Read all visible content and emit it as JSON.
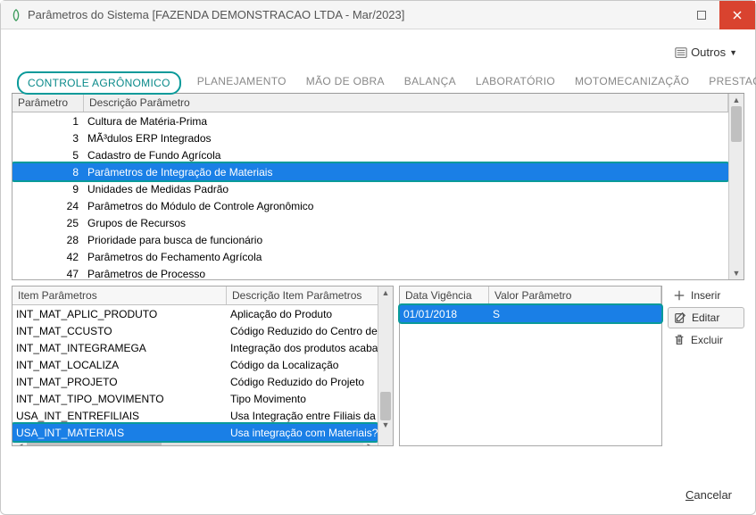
{
  "window": {
    "title": "Parâmetros do Sistema [FAZENDA DEMONSTRACAO LTDA - Mar/2023]"
  },
  "topbar": {
    "outros_label": "Outros"
  },
  "tabs": {
    "items": [
      "CONTROLE AGRÔNOMICO",
      "PLANEJAMENTO",
      "MÃO DE OBRA",
      "BALANÇA",
      "LABORATÓRIO",
      "MOTOMECANIZAÇÃO",
      "PRESTAÇÃO DE SERVIÇOS"
    ],
    "active_index": 0
  },
  "grid1": {
    "headers": {
      "param": "Parâmetro",
      "desc": "Descrição Parâmetro"
    },
    "rows": [
      {
        "id": "1",
        "desc": "Cultura de Matéria-Prima"
      },
      {
        "id": "3",
        "desc": "MÃ³dulos ERP Integrados"
      },
      {
        "id": "5",
        "desc": "Cadastro de Fundo Agrícola"
      },
      {
        "id": "8",
        "desc": "Parâmetros de Integração de Materiais",
        "selected": true
      },
      {
        "id": "9",
        "desc": "Unidades de Medidas Padrão"
      },
      {
        "id": "24",
        "desc": "Parâmetros do Módulo de Controle Agronômico"
      },
      {
        "id": "25",
        "desc": "Grupos de Recursos"
      },
      {
        "id": "28",
        "desc": "Prioridade para busca de funcionário"
      },
      {
        "id": "42",
        "desc": "Parâmetros do Fechamento Agrícola"
      },
      {
        "id": "47",
        "desc": "Parâmetros de Processo"
      }
    ]
  },
  "grid2": {
    "headers": {
      "item": "Item Parâmetros",
      "desc": "Descrição Item Parâmetros"
    },
    "rows": [
      {
        "item": "INT_MAT_APLIC_PRODUTO",
        "desc": "Aplicação do Produto"
      },
      {
        "item": "INT_MAT_CCUSTO",
        "desc": "Código Reduzido do Centro de C"
      },
      {
        "item": "INT_MAT_INTEGRAMEGA",
        "desc": "Integração dos produtos acaba"
      },
      {
        "item": "INT_MAT_LOCALIZA",
        "desc": "Código da Localização"
      },
      {
        "item": "INT_MAT_PROJETO",
        "desc": "Código Reduzido do Projeto"
      },
      {
        "item": "INT_MAT_TIPO_MOVIMENTO",
        "desc": "Tipo Movimento"
      },
      {
        "item": "USA_INT_ENTREFILIAIS",
        "desc": "Usa Integração entre Filiais da"
      },
      {
        "item": "USA_INT_MATERIAIS",
        "desc": "Usa integração com Materiais?",
        "selected": true
      }
    ]
  },
  "grid3": {
    "headers": {
      "date": "Data Vigência",
      "value": "Valor Parâmetro"
    },
    "rows": [
      {
        "date": "01/01/2018",
        "value": "S",
        "selected": true
      }
    ]
  },
  "actions": {
    "insert": "Inserir",
    "edit": "Editar",
    "delete": "Excluir"
  },
  "footer": {
    "cancel_prefix": "C",
    "cancel_rest": "ancelar"
  }
}
